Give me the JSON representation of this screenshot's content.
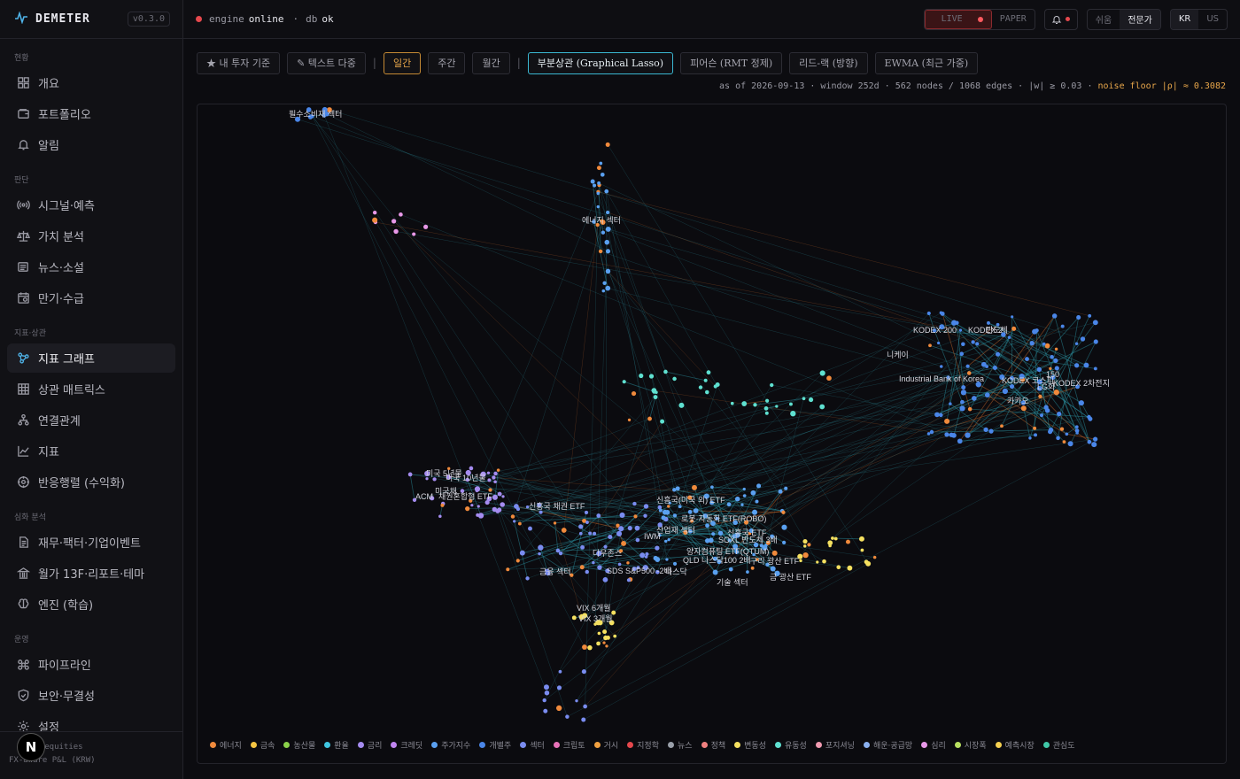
{
  "brand": {
    "name": "DEMETER",
    "version": "v0.3.0"
  },
  "nav": [
    {
      "section": "현황",
      "items": [
        {
          "label": "개요",
          "icon": "grid"
        },
        {
          "label": "포트폴리오",
          "icon": "wallet"
        },
        {
          "label": "알림",
          "icon": "bell"
        }
      ]
    },
    {
      "section": "판단",
      "items": [
        {
          "label": "시그널·예측",
          "icon": "signal"
        },
        {
          "label": "가치 분석",
          "icon": "scale"
        },
        {
          "label": "뉴스·소설",
          "icon": "news"
        },
        {
          "label": "만기·수급",
          "icon": "calendar"
        }
      ]
    },
    {
      "section": "지표·상관",
      "items": [
        {
          "label": "지표 그래프",
          "icon": "graph",
          "active": true
        },
        {
          "label": "상관 매트릭스",
          "icon": "matrix"
        },
        {
          "label": "연결관계",
          "icon": "tree"
        },
        {
          "label": "지표",
          "icon": "chart"
        },
        {
          "label": "반응행렬 (수익화)",
          "icon": "target"
        }
      ]
    },
    {
      "section": "심화 분석",
      "items": [
        {
          "label": "재무·팩터·기업이벤트",
          "icon": "doc"
        },
        {
          "label": "월가 13F·리포트·테마",
          "icon": "bank"
        },
        {
          "label": "엔진 (학습)",
          "icon": "brain"
        }
      ]
    },
    {
      "section": "운영",
      "items": [
        {
          "label": "파이프라인",
          "icon": "pipeline"
        },
        {
          "label": "보안·무결성",
          "icon": "shield"
        },
        {
          "label": "설정",
          "icon": "gear"
        }
      ]
    }
  ],
  "footer": {
    "line1": "KR equities",
    "line2": "FX-aware P&L (KRW)",
    "avatar": "N"
  },
  "topbar": {
    "engine_label": "engine",
    "engine_status": "online",
    "db_label": "db",
    "db_status": "ok",
    "mode_live": "LIVE",
    "mode_paper": "PAPER",
    "level_easy": "쉬움",
    "level_expert": "전문가",
    "lang_kr": "KR",
    "lang_us": "US"
  },
  "toolbar": {
    "chips": [
      "★ 내 투자 기준",
      "✎ 텍스트 다중"
    ],
    "period": [
      "일간",
      "주간",
      "월간"
    ],
    "methods": [
      "부분상관 (Graphical Lasso)",
      "피어슨 (RMT 정제)",
      "리드-랙 (방향)",
      "EWMA (최근 가중)"
    ]
  },
  "meta": {
    "text": "as of 2026-09-13 · window 252d · 562 nodes / 1068 edges · |w| ≥ 0.03 ·",
    "noise": "noise floor |ρ| ≈ 0.3082"
  },
  "labels": [
    "필수소비재 섹터",
    "에너지 섹터",
    "니케이",
    "KODEX 200",
    "KODEX 2",
    "반도체",
    "Industrial Bank of Korea",
    "KODEX 코스피",
    "LG화",
    "KODEX 2차전지",
    "카카오",
    "150",
    "미국 5년물",
    "미국 10년물",
    "미국채",
    "ACM",
    "채권혼합형 ETF",
    "신흥국 채권 ETF",
    "신흥국(미국 외) ETF",
    "로봇·자동화 ETF(ROBO)",
    "산업재 섹터",
    "IWM",
    "신흥국 ETF",
    "SOXL 반도체 3배",
    "양자컴퓨팅 ETF(QTUM)",
    "QLD 나스닥100 2배",
    "구리 광산 ETF",
    "다우존스",
    "금융 섹터",
    "SDS S&P500 -2배",
    "나스닥",
    "기술 섹터",
    "금 광산 ETF",
    "VIX 6개월",
    "VIX 3개월"
  ],
  "legend": [
    {
      "label": "에너지",
      "color": "#f08a3c"
    },
    {
      "label": "금속",
      "color": "#f5c542"
    },
    {
      "label": "농산물",
      "color": "#8bd14a"
    },
    {
      "label": "환율",
      "color": "#3fc5e0"
    },
    {
      "label": "금리",
      "color": "#a58cf0"
    },
    {
      "label": "크레딧",
      "color": "#c085f0"
    },
    {
      "label": "주가지수",
      "color": "#5aa0f0"
    },
    {
      "label": "개별주",
      "color": "#4a86e8"
    },
    {
      "label": "섹터",
      "color": "#7a8cf0"
    },
    {
      "label": "크립토",
      "color": "#e872b8"
    },
    {
      "label": "거시",
      "color": "#f0a040"
    },
    {
      "label": "지정학",
      "color": "#e5484d"
    },
    {
      "label": "뉴스",
      "color": "#9aa0aa"
    },
    {
      "label": "정책",
      "color": "#f08080"
    },
    {
      "label": "변동성",
      "color": "#f5e060"
    },
    {
      "label": "유동성",
      "color": "#5fe0d0"
    },
    {
      "label": "포지셔닝",
      "color": "#f09ab0"
    },
    {
      "label": "해운·공급망",
      "color": "#8ab0f0"
    },
    {
      "label": "심리",
      "color": "#e898e8"
    },
    {
      "label": "시장폭",
      "color": "#b8e060"
    },
    {
      "label": "예측시장",
      "color": "#f5d050"
    },
    {
      "label": "관심도",
      "color": "#40c8a8"
    }
  ]
}
